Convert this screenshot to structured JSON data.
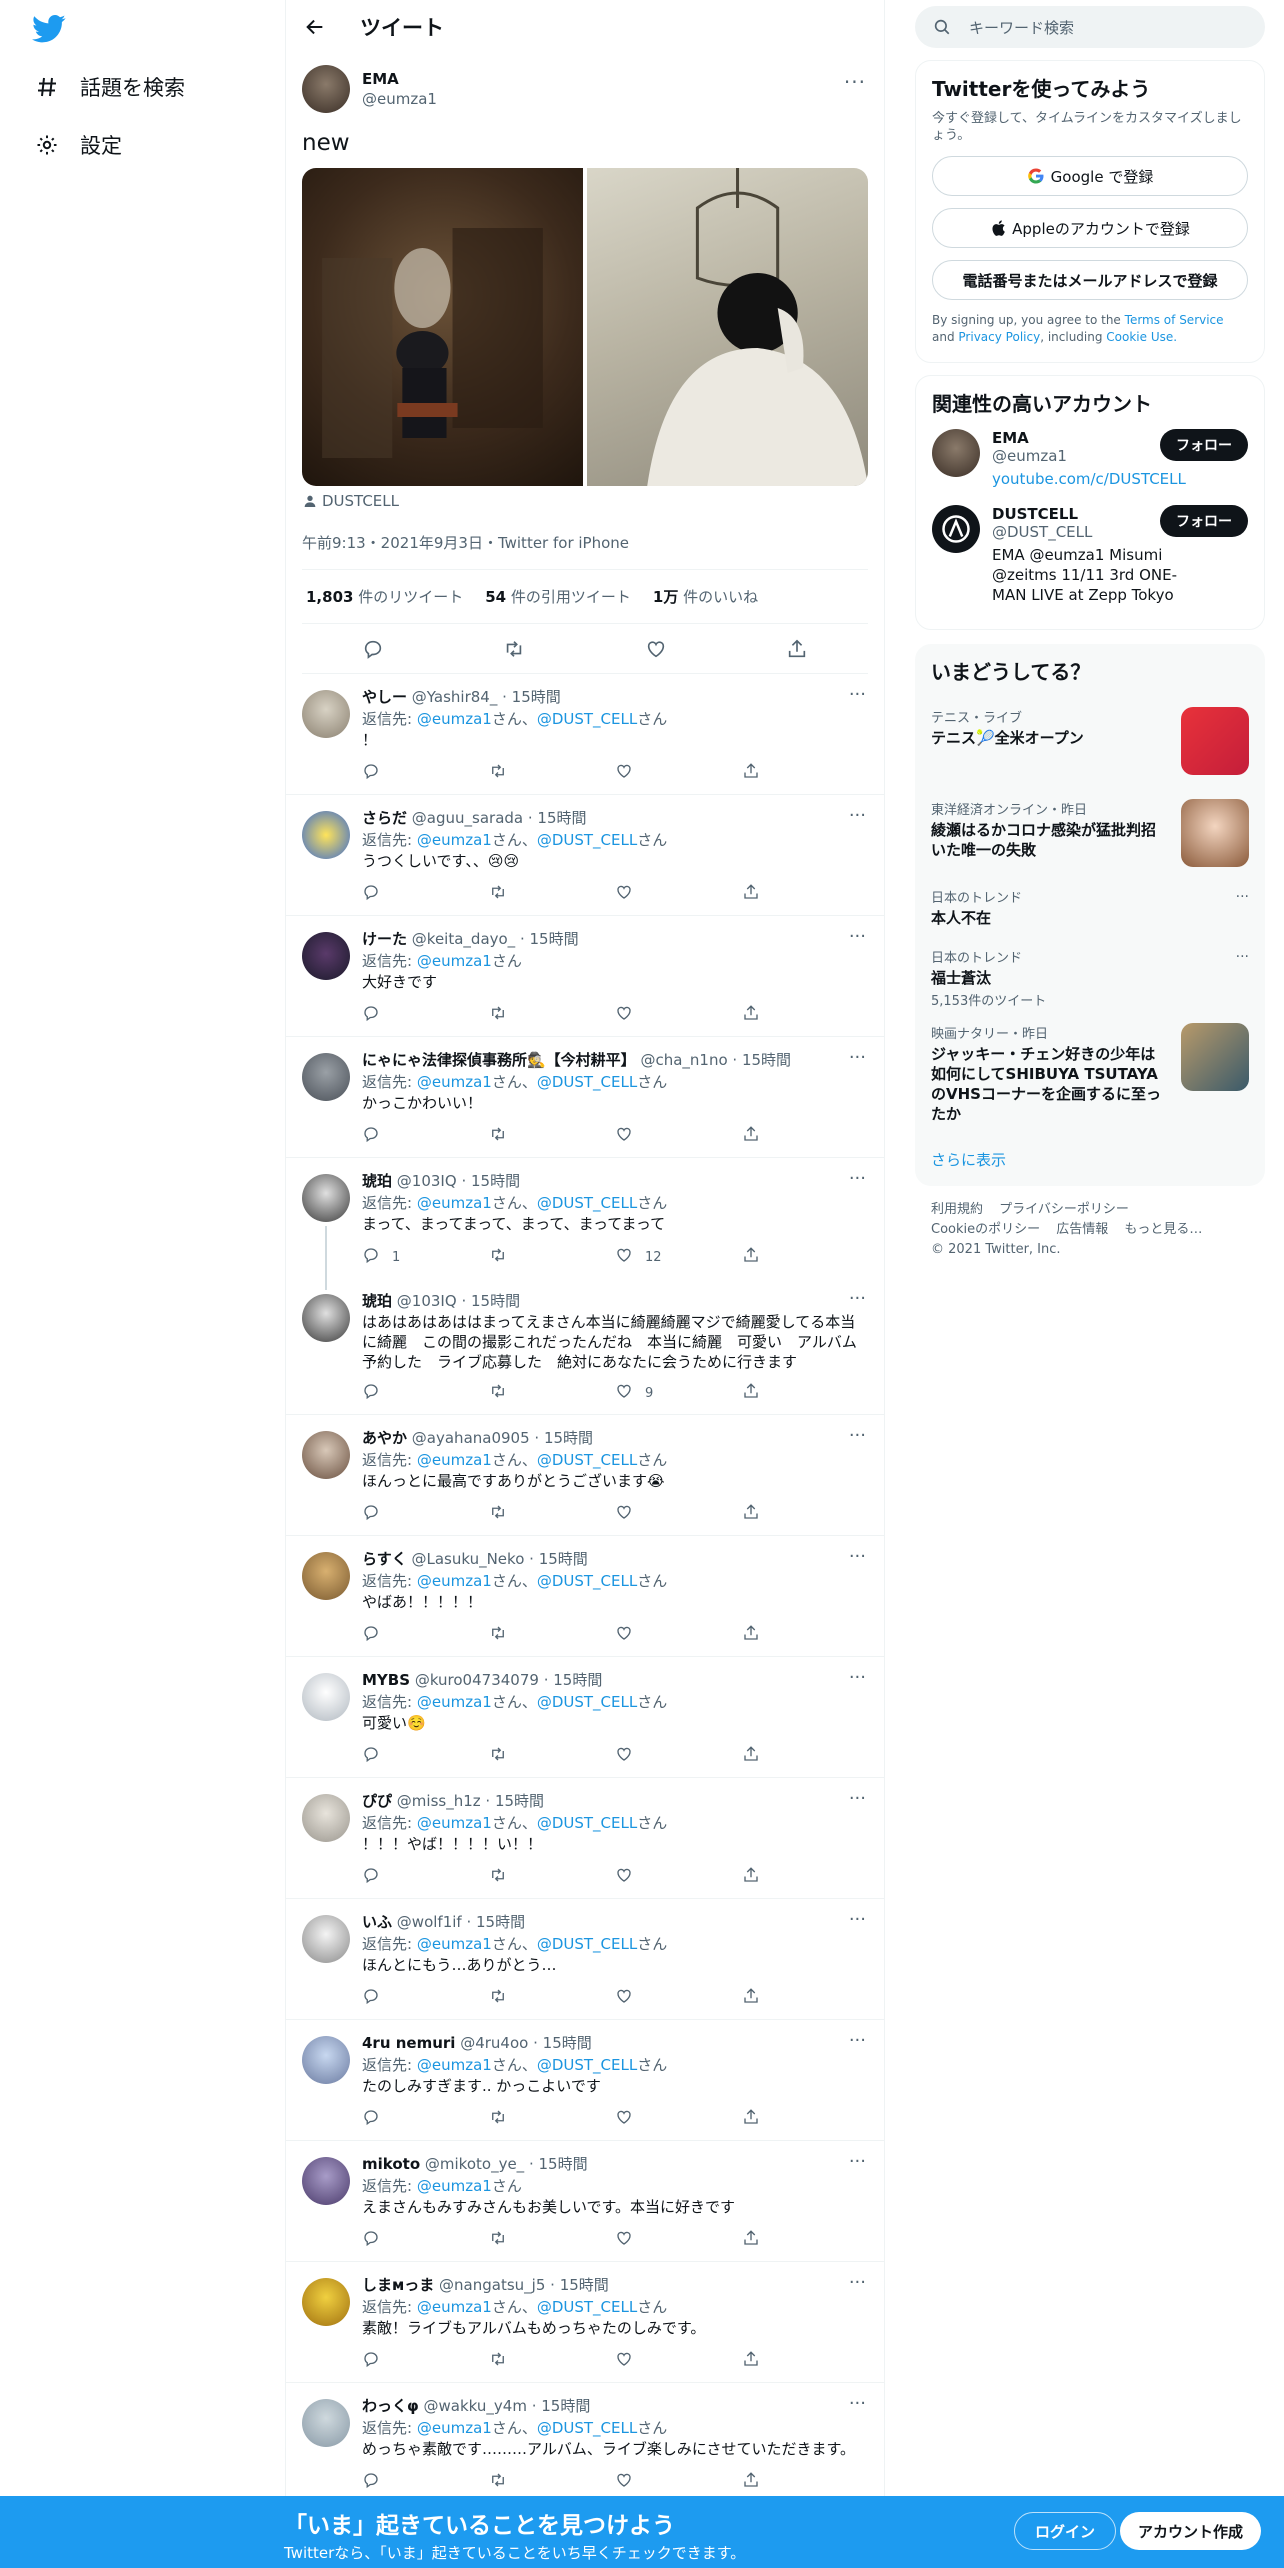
{
  "nav": {
    "items": [
      {
        "label": "話題を検索",
        "icon": "hashtag-icon"
      },
      {
        "label": "設定",
        "icon": "gear-icon"
      }
    ]
  },
  "header": {
    "title": "ツイート"
  },
  "tweet": {
    "name": "EMA",
    "handle": "@eumza1",
    "text": "new",
    "media_credit": "DUSTCELL",
    "timestamp": "午前9:13・2021年9月3日・Twitter for iPhone",
    "stats": {
      "retweets_num": "1,803",
      "retweets_label": "件のリツイート",
      "quotes_num": "54",
      "quotes_label": "件の引用ツイート",
      "likes_num": "1万",
      "likes_label": "件のいいね"
    }
  },
  "replies": [
    {
      "name": "やしー",
      "handle": "@Yashir84_",
      "time": "15時間",
      "to_prefix": "返信先:",
      "to": "@eumza1",
      "to_sep": "さん、",
      "to2": "@DUST_CELL",
      "to_suffix": "さん",
      "text": "！",
      "replies": "",
      "likes": ""
    },
    {
      "name": "さらだ",
      "handle": "@aguu_sarada",
      "time": "15時間",
      "to_prefix": "返信先:",
      "to": "@eumza1",
      "to_sep": "さん、",
      "to2": "@DUST_CELL",
      "to_suffix": "さん",
      "text": "うつくしいです、、😢😢",
      "replies": "",
      "likes": ""
    },
    {
      "name": "けーた",
      "handle": "@keita_dayo_",
      "time": "15時間",
      "to_prefix": "返信先:",
      "to": "@eumza1",
      "to_sep": "さん",
      "to2": "",
      "to_suffix": "",
      "text": "大好きです",
      "replies": "",
      "likes": ""
    },
    {
      "name": "にゃにゃ法律探偵事務所🕵【今村耕平】",
      "handle": "@cha_n1no",
      "time": "15時間",
      "to_prefix": "返信先:",
      "to": "@eumza1",
      "to_sep": "さん、",
      "to2": "@DUST_CELL",
      "to_suffix": "さん",
      "text": "かっこかわいい！",
      "replies": "",
      "likes": ""
    },
    {
      "name": "琥珀",
      "handle": "@103IQ",
      "time": "15時間",
      "to_prefix": "返信先:",
      "to": "@eumza1",
      "to_sep": "さん、",
      "to2": "@DUST_CELL",
      "to_suffix": "さん",
      "text": "まって、まってまって、まって、まってまって",
      "replies": "1",
      "likes": "12"
    },
    {
      "name": "琥珀",
      "handle": "@103IQ",
      "time": "15時間",
      "to_prefix": "",
      "to": "",
      "to_sep": "",
      "to2": "",
      "to_suffix": "",
      "text": "はあはあはあははまってえまさん本当に綺麗綺麗マジで綺麗愛してる本当に綺麗　この間の撮影これだったんだね　本当に綺麗　可愛い　アルバム予約した　ライブ応募した　絶対にあなたに会うために行きます",
      "replies": "",
      "likes": "9"
    },
    {
      "name": "あやか",
      "handle": "@ayahana0905",
      "time": "15時間",
      "to_prefix": "返信先:",
      "to": "@eumza1",
      "to_sep": "さん、",
      "to2": "@DUST_CELL",
      "to_suffix": "さん",
      "text": "ほんっとに最高ですありがとうございます😭",
      "replies": "",
      "likes": ""
    },
    {
      "name": "らすく",
      "handle": "@Lasuku_Neko",
      "time": "15時間",
      "to_prefix": "返信先:",
      "to": "@eumza1",
      "to_sep": "さん、",
      "to2": "@DUST_CELL",
      "to_suffix": "さん",
      "text": "やばあ！！！！！",
      "replies": "",
      "likes": ""
    },
    {
      "name": "MYBS",
      "handle": "@kuro04734079",
      "time": "15時間",
      "to_prefix": "返信先:",
      "to": "@eumza1",
      "to_sep": "さん、",
      "to2": "@DUST_CELL",
      "to_suffix": "さん",
      "text": "可愛い☺️",
      "replies": "",
      "likes": ""
    },
    {
      "name": "ぴぴ",
      "handle": "@miss_h1z",
      "time": "15時間",
      "to_prefix": "返信先:",
      "to": "@eumza1",
      "to_sep": "さん、",
      "to2": "@DUST_CELL",
      "to_suffix": "さん",
      "text": "！！！やば！！！！い！！",
      "replies": "",
      "likes": ""
    },
    {
      "name": "いふ",
      "handle": "@wolf1if",
      "time": "15時間",
      "to_prefix": "返信先:",
      "to": "@eumza1",
      "to_sep": "さん、",
      "to2": "@DUST_CELL",
      "to_suffix": "さん",
      "text": "ほんとにもう…ありがとう…",
      "replies": "",
      "likes": ""
    },
    {
      "name": "4ru nemuri",
      "handle": "@4ru4oo",
      "time": "15時間",
      "to_prefix": "返信先:",
      "to": "@eumza1",
      "to_sep": "さん、",
      "to2": "@DUST_CELL",
      "to_suffix": "さん",
      "text": "たのしみすぎます.. かっこよいです",
      "replies": "",
      "likes": ""
    },
    {
      "name": "mikoto",
      "handle": "@mikoto_ye_",
      "time": "15時間",
      "to_prefix": "返信先:",
      "to": "@eumza1",
      "to_sep": "さん",
      "to2": "",
      "to_suffix": "",
      "text": "えまさんもみすみさんもお美しいです。本当に好きです",
      "replies": "",
      "likes": ""
    },
    {
      "name": "しまмっま",
      "handle": "@nangatsu_j5",
      "time": "15時間",
      "to_prefix": "返信先:",
      "to": "@eumza1",
      "to_sep": "さん、",
      "to2": "@DUST_CELL",
      "to_suffix": "さん",
      "text": "素敵！ライブもアルバムもめっちゃたのしみです。",
      "replies": "",
      "likes": ""
    },
    {
      "name": "わっくφ",
      "handle": "@wakku_y4m",
      "time": "15時間",
      "to_prefix": "返信先:",
      "to": "@eumza1",
      "to_sep": "さん、",
      "to2": "@DUST_CELL",
      "to_suffix": "さん",
      "text": "めっちゃ素敵です………アルバム、ライブ楽しみにさせていただきます。",
      "replies": "",
      "likes": ""
    }
  ],
  "sidebar": {
    "search_placeholder": "キーワード検索",
    "signup": {
      "title": "Twitterを使ってみよう",
      "subtitle": "今すぐ登録して、タイムラインをカスタマイズしましょう。",
      "google": "Google で登録",
      "apple": "Appleのアカウントで登録",
      "phone": "電話番号またはメールアドレスで登録",
      "legal_pre": "By signing up, you agree to the",
      "terms": "Terms of Service",
      "and": "and",
      "privacy": "Privacy Policy",
      "including": ", including",
      "cookie": "Cookie Use."
    },
    "related": {
      "title": "関連性の高いアカウント",
      "follow_label": "フォロー",
      "accounts": [
        {
          "name": "EMA",
          "handle": "@eumza1",
          "bio_link": "youtube.com/c/DUSTCELL",
          "bio": ""
        },
        {
          "name": "DUSTCELL",
          "handle": "@DUST_CELL",
          "bio_link": "",
          "bio": "EMA @eumza1 Misumi @zeitms 11/11 3rd ONE-MAN LIVE at Zepp Tokyo"
        }
      ]
    },
    "trends": {
      "title": "いまどうしてる？",
      "items": [
        {
          "meta": "テニス・ライブ",
          "title": "テニス🎾全米オープン",
          "count": ""
        },
        {
          "meta": "東洋経済オンライン・昨日",
          "title": "綾瀬はるかコロナ感染が猛批判招いた唯一の失敗",
          "count": ""
        },
        {
          "meta": "日本のトレンド",
          "title": "本人不在",
          "count": ""
        },
        {
          "meta": "日本のトレンド",
          "title": "福士蒼汰",
          "count": "5,153件のツイート"
        },
        {
          "meta": "映画ナタリー・昨日",
          "title": "ジャッキー・チェン好きの少年は如何にしてSHIBUYA TSUTAYAのVHSコーナーを企画するに至ったか",
          "count": ""
        }
      ],
      "show_more": "さらに表示"
    },
    "footer": {
      "links": [
        "利用規約",
        "プライバシーポリシー",
        "Cookieのポリシー",
        "広告情報",
        "もっと見る…"
      ],
      "copyright": "© 2021 Twitter, Inc."
    }
  },
  "bottom": {
    "title": "「いま」起きていることを見つけよう",
    "subtitle": "Twitterなら、「いま」起きていることをいち早くチェックできます。",
    "login": "ログイン",
    "signup": "アカウント作成"
  },
  "colors": {
    "accent": "#1d9bf0",
    "link": "#1b95e0",
    "text": "#0f1419",
    "muted": "#536471"
  }
}
